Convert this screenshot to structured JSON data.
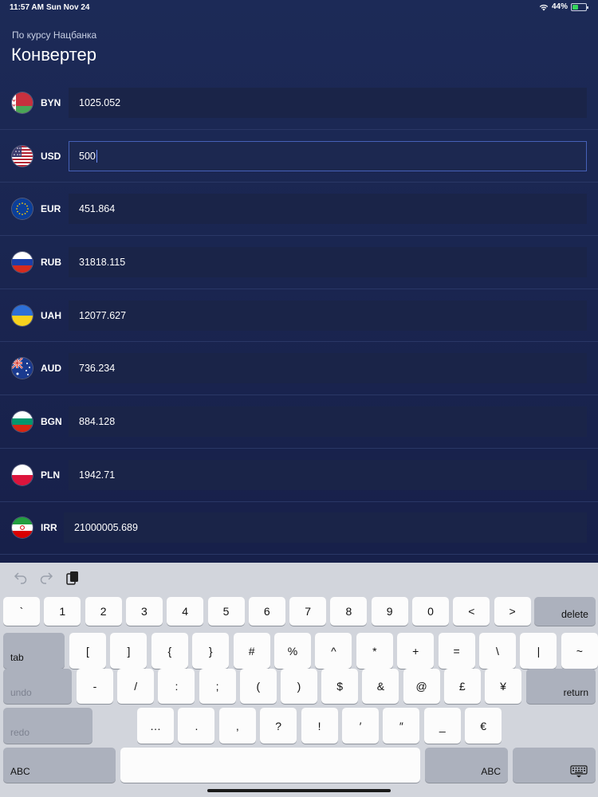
{
  "status_bar": {
    "time": "11:57 AM",
    "date": "Sun Nov 24",
    "battery": "44%",
    "battery_level": 0.44
  },
  "header": {
    "subtitle": "По курсу Нацбанка",
    "title": "Конвертер"
  },
  "currencies": [
    {
      "code": "BYN",
      "value": "1025.052"
    },
    {
      "code": "USD",
      "value": "500",
      "active": true
    },
    {
      "code": "EUR",
      "value": "451.864"
    },
    {
      "code": "RUB",
      "value": "31818.115"
    },
    {
      "code": "UAH",
      "value": "12077.627"
    },
    {
      "code": "AUD",
      "value": "736.234"
    },
    {
      "code": "BGN",
      "value": "884.128"
    },
    {
      "code": "PLN",
      "value": "1942.71"
    },
    {
      "code": "IRR",
      "value": "21000005.689"
    }
  ],
  "keyboard": {
    "row1": [
      "`",
      "1",
      "2",
      "3",
      "4",
      "5",
      "6",
      "7",
      "8",
      "9",
      "0",
      "<",
      ">"
    ],
    "delete": "delete",
    "tab": "tab",
    "row2": [
      "[",
      "]",
      "{",
      "}",
      "#",
      "%",
      "^",
      "*",
      "+",
      "=",
      "\\",
      "|",
      "~"
    ],
    "undo": "undo",
    "row3": [
      "-",
      "/",
      ":",
      ";",
      "(",
      ")",
      "$",
      "&",
      "@",
      "£",
      "¥"
    ],
    "return": "return",
    "redo": "redo",
    "row4": [
      "…",
      ".",
      ",",
      "?",
      "!",
      "′",
      "″",
      "_",
      "€"
    ],
    "abc_left": "ABC",
    "abc_right": "ABC"
  }
}
